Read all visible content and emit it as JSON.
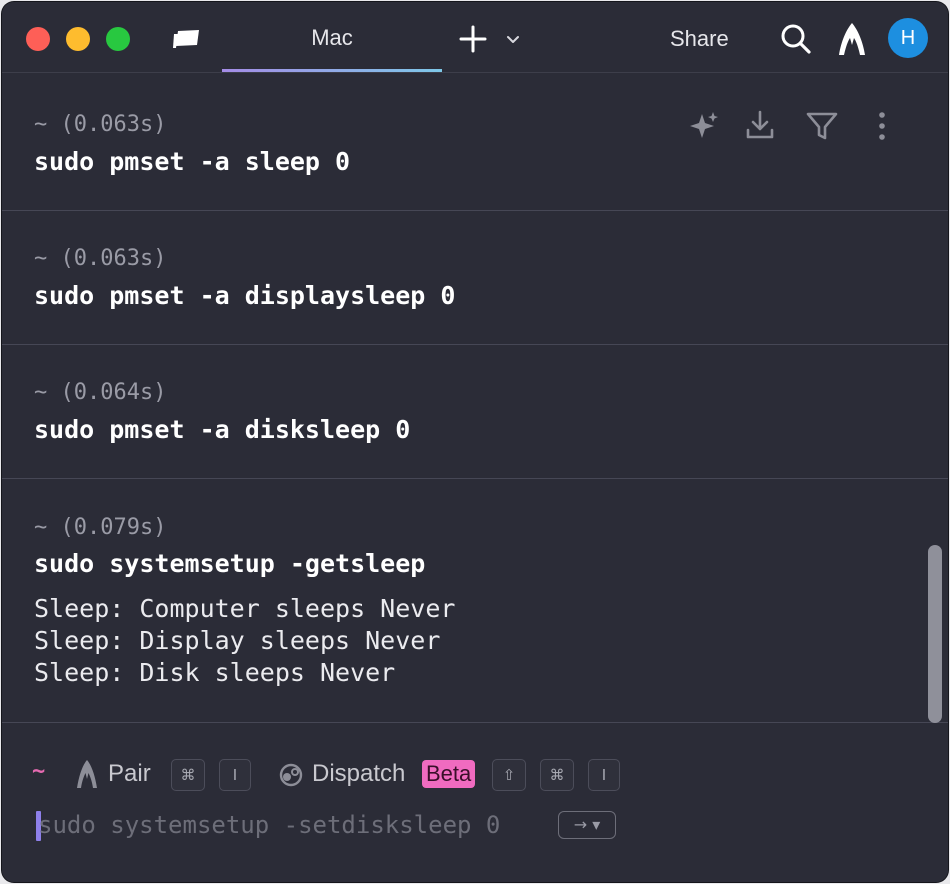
{
  "titlebar": {
    "tab_label": "Mac",
    "share_label": "Share",
    "avatar_initial": "H",
    "icons": [
      "tabs-icon",
      "plus-icon",
      "chevron-down-icon",
      "search-icon",
      "warp-logo-icon"
    ]
  },
  "blocks": [
    {
      "meta": "~ (0.063s)",
      "command": "sudo pmset -a sleep 0"
    },
    {
      "meta": "~ (0.063s)",
      "command": "sudo pmset -a displaysleep 0"
    },
    {
      "meta": "~ (0.064s)",
      "command": "sudo pmset -a disksleep 0"
    },
    {
      "meta": "~ (0.079s)",
      "command": "sudo systemsetup -getsleep",
      "output": [
        "Sleep: Computer sleeps Never",
        "Sleep: Display sleeps Never",
        "Sleep: Disk sleeps Never"
      ]
    }
  ],
  "block_actions": [
    "sparkles-icon",
    "download-icon",
    "filter-icon",
    "more-vertical-icon"
  ],
  "input": {
    "prompt_symbol": "~",
    "pair_label": "Pair",
    "pair_shortcut": [
      "⌘",
      "I"
    ],
    "dispatch_label": "Dispatch",
    "dispatch_badge": "Beta",
    "dispatch_shortcut": [
      "⇧",
      "⌘",
      "I"
    ],
    "suggestion": "sudo systemsetup -setdisksleep 0",
    "accept_hint": "→ ▾"
  },
  "colors": {
    "background": "#2b2c37",
    "tab_underline_start": "#a48ce6",
    "tab_underline_end": "#7ec8e8",
    "prompt": "#e56ab0",
    "beta_badge": "#f06bc0",
    "cursor": "#8e80ea",
    "avatar": "#1d8fe0"
  }
}
